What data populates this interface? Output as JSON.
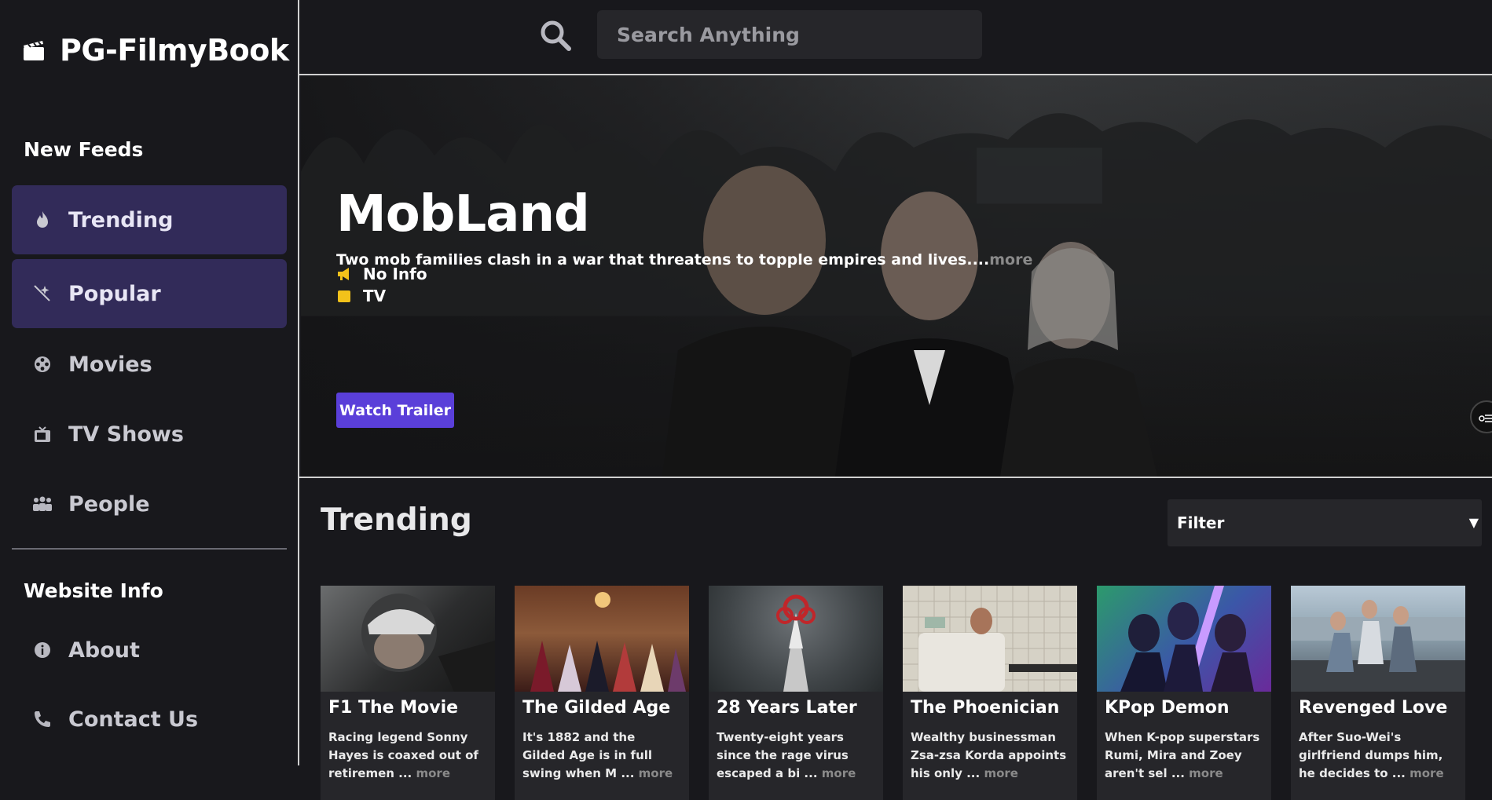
{
  "brand": {
    "name": "PG-FilmyBook",
    "icon": "clapperboard-icon"
  },
  "sidebar": {
    "feeds_title": "New Feeds",
    "items": [
      {
        "label": "Trending",
        "icon": "fire-icon",
        "active": true
      },
      {
        "label": "Popular",
        "icon": "sparkle-icon",
        "active": true
      },
      {
        "label": "Movies",
        "icon": "film-reel-icon",
        "active": false
      },
      {
        "label": "TV Shows",
        "icon": "tv-icon",
        "active": false
      },
      {
        "label": "People",
        "icon": "people-icon",
        "active": false
      }
    ],
    "info_title": "Website Info",
    "info_items": [
      {
        "label": "About",
        "icon": "info-icon"
      },
      {
        "label": "Contact Us",
        "icon": "phone-icon"
      }
    ]
  },
  "search": {
    "placeholder": "Search Anything",
    "icon": "search-icon"
  },
  "hero": {
    "title": "MobLand",
    "description": "Two mob families clash in a war that threatens to topple empires and lives....",
    "more": "more",
    "meta": [
      {
        "icon": "megaphone-icon",
        "text": "No Info"
      },
      {
        "icon": "tv-icon",
        "text": "TV"
      }
    ],
    "button": "Watch Trailer"
  },
  "trending": {
    "title": "Trending",
    "filter_label": "Filter",
    "cards": [
      {
        "title": "F1 The Movie",
        "desc": "Racing legend Sonny Hayes is coaxed out of retiremen ...",
        "more": "more"
      },
      {
        "title": "The Gilded Age",
        "desc": "It's 1882 and the Gilded Age is in full swing when M ...",
        "more": "more"
      },
      {
        "title": "28 Years Later",
        "desc": "Twenty-eight years since the rage virus escaped a bi ...",
        "more": "more"
      },
      {
        "title": "The Phoenician",
        "desc": "Wealthy businessman Zsa-zsa Korda appoints his only ...",
        "more": "more"
      },
      {
        "title": "KPop Demon",
        "desc": "When K-pop superstars Rumi, Mira and Zoey aren't sel ...",
        "more": "more"
      },
      {
        "title": "Revenged Love",
        "desc": "After Suo-Wei's girlfriend dumps him, he decides to ...",
        "more": "more"
      }
    ]
  },
  "colors": {
    "accent": "#5a3fd9",
    "active_nav": "#322b59",
    "background": "#18181c",
    "panel": "#26262a"
  }
}
